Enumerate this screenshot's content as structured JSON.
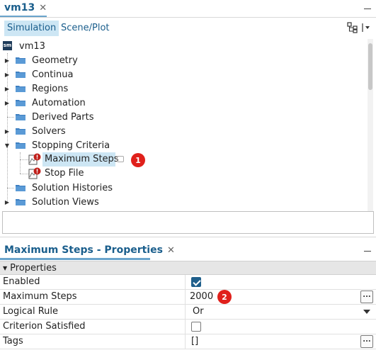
{
  "top_panel": {
    "tab_title": "vm13",
    "close_glyph": "✕",
    "subtabs": [
      {
        "label": "Simulation",
        "active": true
      },
      {
        "label": "Scene/Plot",
        "active": false
      }
    ],
    "toolbar_icons": [
      "hierarchy-icon",
      "dropdown-menu-icon"
    ]
  },
  "tree": {
    "root": {
      "label": "vm13",
      "icon": "sim-icon",
      "icon_text": "sm"
    },
    "items": [
      {
        "label": "Geometry",
        "icon": "folder-icon",
        "expandable": true
      },
      {
        "label": "Continua",
        "icon": "folder-icon",
        "expandable": true
      },
      {
        "label": "Regions",
        "icon": "folder-icon",
        "expandable": true
      },
      {
        "label": "Automation",
        "icon": "folder-icon",
        "expandable": true
      },
      {
        "label": "Derived Parts",
        "icon": "folder-icon",
        "expandable": false
      },
      {
        "label": "Solvers",
        "icon": "folder-icon",
        "expandable": true
      },
      {
        "label": "Stopping Criteria",
        "icon": "folder-icon",
        "expandable": true,
        "expanded": true,
        "children": [
          {
            "label": "Maximum Steps",
            "icon": "stopping-criterion-icon",
            "selected": true,
            "callout": "1"
          },
          {
            "label": "Stop File",
            "icon": "stopping-criterion-icon"
          }
        ]
      },
      {
        "label": "Solution Histories",
        "icon": "folder-icon",
        "expandable": false
      },
      {
        "label": "Solution Views",
        "icon": "folder-icon",
        "expandable": true
      }
    ]
  },
  "properties_panel": {
    "title": "Maximum Steps - Properties",
    "close_glyph": "✕",
    "section_label": "Properties",
    "rows": [
      {
        "name": "Enabled",
        "type": "checkbox",
        "checked": true
      },
      {
        "name": "Maximum Steps",
        "type": "text",
        "value": "2000",
        "has_ellipsis": true,
        "callout": "2"
      },
      {
        "name": "Logical Rule",
        "type": "dropdown",
        "value": "Or"
      },
      {
        "name": "Criterion Satisfied",
        "type": "checkbox",
        "checked": false
      },
      {
        "name": "Tags",
        "type": "text",
        "value": "[]",
        "has_ellipsis": true
      }
    ],
    "ellipsis_label": "..."
  },
  "colors": {
    "accent": "#1a5e8c",
    "selection": "#cde6f4",
    "callout": "#e0201b",
    "folder": "#3d7fc1"
  }
}
